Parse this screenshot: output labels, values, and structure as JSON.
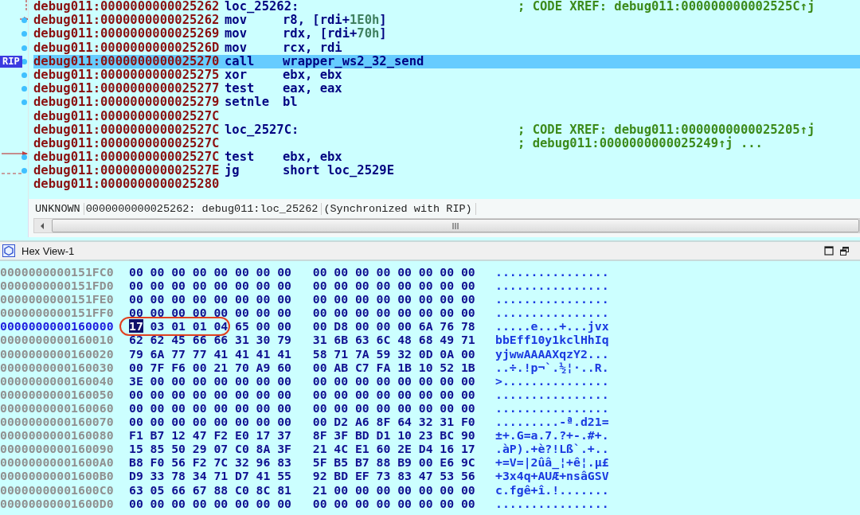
{
  "listing": {
    "rip_label": "RIP",
    "lines": [
      {
        "address": "debug011:0000000000025262",
        "kind": "label",
        "label": "loc_25262:",
        "comment": "; CODE XREF: debug011:000000000002525C↑j",
        "dot": false,
        "selected": false
      },
      {
        "address": "debug011:0000000000025262",
        "kind": "insn",
        "mnemonic": "mov",
        "operands": [
          {
            "text": "r8, [rdi+",
            "kind": "reg"
          },
          {
            "text": "1E0h",
            "kind": "imm"
          },
          {
            "text": "]",
            "kind": "reg"
          }
        ],
        "dot": true,
        "selected": false
      },
      {
        "address": "debug011:0000000000025269",
        "kind": "insn",
        "mnemonic": "mov",
        "operands": [
          {
            "text": "rdx, [rdi+",
            "kind": "reg"
          },
          {
            "text": "70h",
            "kind": "imm"
          },
          {
            "text": "]",
            "kind": "reg"
          }
        ],
        "dot": true,
        "selected": false
      },
      {
        "address": "debug011:000000000002526D",
        "kind": "insn",
        "mnemonic": "mov",
        "operands": [
          {
            "text": "rcx, rdi",
            "kind": "reg"
          }
        ],
        "dot": true,
        "selected": false
      },
      {
        "address": "debug011:0000000000025270",
        "kind": "insn",
        "mnemonic": "call",
        "operands": [
          {
            "text": "wrapper_ws2_32_send",
            "kind": "reg"
          }
        ],
        "dot": true,
        "selected": true
      },
      {
        "address": "debug011:0000000000025275",
        "kind": "insn",
        "mnemonic": "xor",
        "operands": [
          {
            "text": "ebx, ebx",
            "kind": "reg"
          }
        ],
        "dot": true,
        "selected": false
      },
      {
        "address": "debug011:0000000000025277",
        "kind": "insn",
        "mnemonic": "test",
        "operands": [
          {
            "text": "eax, eax",
            "kind": "reg"
          }
        ],
        "dot": true,
        "selected": false
      },
      {
        "address": "debug011:0000000000025279",
        "kind": "insn",
        "mnemonic": "setnle",
        "operands": [
          {
            "text": "bl",
            "kind": "reg"
          }
        ],
        "dot": true,
        "selected": false
      },
      {
        "address": "debug011:000000000002527C",
        "kind": "plain",
        "dot": false,
        "selected": false
      },
      {
        "address": "debug011:000000000002527C",
        "kind": "label",
        "label": "loc_2527C:",
        "comment": "; CODE XREF: debug011:0000000000025205↑j",
        "dot": false,
        "selected": false
      },
      {
        "address": "debug011:000000000002527C",
        "kind": "plain",
        "comment": "; debug011:0000000000025249↑j ...",
        "dot": false,
        "selected": false
      },
      {
        "address": "debug011:000000000002527C",
        "kind": "insn",
        "mnemonic": "test",
        "operands": [
          {
            "text": "ebx, ebx",
            "kind": "reg"
          }
        ],
        "dot": true,
        "selected": false
      },
      {
        "address": "debug011:000000000002527E",
        "kind": "insn",
        "mnemonic": "jg",
        "operands": [
          {
            "text": "short loc_2529E",
            "kind": "reg"
          }
        ],
        "dot": true,
        "selected": false
      },
      {
        "address": "debug011:0000000000025280",
        "kind": "plain",
        "dot": false,
        "selected": false
      }
    ]
  },
  "status_bar": {
    "fields": [
      "UNKNOWN",
      "0000000000025262: debug011:loc_25262",
      "(Synchronized with RIP)"
    ]
  },
  "hex_view": {
    "title": "Hex View-1",
    "rows": [
      {
        "address": "0000000000151FC0",
        "selected": false,
        "circled": false,
        "bytes": [
          "00",
          "00",
          "00",
          "00",
          "00",
          "00",
          "00",
          "00",
          "00",
          "00",
          "00",
          "00",
          "00",
          "00",
          "00",
          "00"
        ],
        "ascii": "................"
      },
      {
        "address": "0000000000151FD0",
        "selected": false,
        "circled": false,
        "bytes": [
          "00",
          "00",
          "00",
          "00",
          "00",
          "00",
          "00",
          "00",
          "00",
          "00",
          "00",
          "00",
          "00",
          "00",
          "00",
          "00"
        ],
        "ascii": "................"
      },
      {
        "address": "0000000000151FE0",
        "selected": false,
        "circled": false,
        "bytes": [
          "00",
          "00",
          "00",
          "00",
          "00",
          "00",
          "00",
          "00",
          "00",
          "00",
          "00",
          "00",
          "00",
          "00",
          "00",
          "00"
        ],
        "ascii": "................"
      },
      {
        "address": "0000000000151FF0",
        "selected": false,
        "circled": false,
        "bytes": [
          "00",
          "00",
          "00",
          "00",
          "00",
          "00",
          "00",
          "00",
          "00",
          "00",
          "00",
          "00",
          "00",
          "00",
          "00",
          "00"
        ],
        "ascii": "................"
      },
      {
        "address": "0000000000160000",
        "selected": true,
        "circled": true,
        "bytes": [
          "17",
          "03",
          "01",
          "01",
          "04",
          "65",
          "00",
          "00",
          "00",
          "D8",
          "00",
          "00",
          "00",
          "6A",
          "76",
          "78"
        ],
        "ascii": ".....e...+...jvx"
      },
      {
        "address": "0000000000160010",
        "selected": false,
        "circled": false,
        "bytes": [
          "62",
          "62",
          "45",
          "66",
          "66",
          "31",
          "30",
          "79",
          "31",
          "6B",
          "63",
          "6C",
          "48",
          "68",
          "49",
          "71"
        ],
        "ascii": "bbEff10y1kclHhIq"
      },
      {
        "address": "0000000000160020",
        "selected": false,
        "circled": false,
        "bytes": [
          "79",
          "6A",
          "77",
          "77",
          "41",
          "41",
          "41",
          "41",
          "58",
          "71",
          "7A",
          "59",
          "32",
          "0D",
          "0A",
          "00"
        ],
        "ascii": "yjwwAAAAXqzY2..."
      },
      {
        "address": "0000000000160030",
        "selected": false,
        "circled": false,
        "bytes": [
          "00",
          "7F",
          "F6",
          "00",
          "21",
          "70",
          "A9",
          "60",
          "00",
          "AB",
          "C7",
          "FA",
          "1B",
          "10",
          "52",
          "1B"
        ],
        "ascii": "..÷.!p¬`.½¦·..R."
      },
      {
        "address": "0000000000160040",
        "selected": false,
        "circled": false,
        "bytes": [
          "3E",
          "00",
          "00",
          "00",
          "00",
          "00",
          "00",
          "00",
          "00",
          "00",
          "00",
          "00",
          "00",
          "00",
          "00",
          "00"
        ],
        "ascii": ">..............."
      },
      {
        "address": "0000000000160050",
        "selected": false,
        "circled": false,
        "bytes": [
          "00",
          "00",
          "00",
          "00",
          "00",
          "00",
          "00",
          "00",
          "00",
          "00",
          "00",
          "00",
          "00",
          "00",
          "00",
          "00"
        ],
        "ascii": "................"
      },
      {
        "address": "0000000000160060",
        "selected": false,
        "circled": false,
        "bytes": [
          "00",
          "00",
          "00",
          "00",
          "00",
          "00",
          "00",
          "00",
          "00",
          "00",
          "00",
          "00",
          "00",
          "00",
          "00",
          "00"
        ],
        "ascii": "................"
      },
      {
        "address": "0000000000160070",
        "selected": false,
        "circled": false,
        "bytes": [
          "00",
          "00",
          "00",
          "00",
          "00",
          "00",
          "00",
          "00",
          "00",
          "D2",
          "A6",
          "8F",
          "64",
          "32",
          "31",
          "F0"
        ],
        "ascii": ".........-ª.d21="
      },
      {
        "address": "0000000000160080",
        "selected": false,
        "circled": false,
        "bytes": [
          "F1",
          "B7",
          "12",
          "47",
          "F2",
          "E0",
          "17",
          "37",
          "8F",
          "3F",
          "BD",
          "D1",
          "10",
          "23",
          "BC",
          "90"
        ],
        "ascii": "±+.G=a.7.?+-.#+."
      },
      {
        "address": "0000000000160090",
        "selected": false,
        "circled": false,
        "bytes": [
          "15",
          "85",
          "50",
          "29",
          "07",
          "C0",
          "8A",
          "3F",
          "21",
          "4C",
          "E1",
          "60",
          "2E",
          "D4",
          "16",
          "17"
        ],
        "ascii": ".àP).+è?!Lß`.+.."
      },
      {
        "address": "00000000001600A0",
        "selected": false,
        "circled": false,
        "bytes": [
          "B8",
          "F0",
          "56",
          "F2",
          "7C",
          "32",
          "96",
          "83",
          "5F",
          "B5",
          "B7",
          "88",
          "B9",
          "00",
          "E6",
          "9C"
        ],
        "ascii": "+=V=|2ûâ_¦+ê¦.µ£"
      },
      {
        "address": "00000000001600B0",
        "selected": false,
        "circled": false,
        "bytes": [
          "D9",
          "33",
          "78",
          "34",
          "71",
          "D7",
          "41",
          "55",
          "92",
          "BD",
          "EF",
          "73",
          "83",
          "47",
          "53",
          "56"
        ],
        "ascii": "+3x4q+AUÆ+nsâGSV"
      },
      {
        "address": "00000000001600C0",
        "selected": false,
        "circled": false,
        "bytes": [
          "63",
          "05",
          "66",
          "67",
          "88",
          "C0",
          "8C",
          "81",
          "21",
          "00",
          "00",
          "00",
          "00",
          "00",
          "00",
          "00"
        ],
        "ascii": "c.fgê+î.!......."
      },
      {
        "address": "00000000001600D0",
        "selected": false,
        "circled": false,
        "bytes": [
          "00",
          "00",
          "00",
          "00",
          "00",
          "00",
          "00",
          "00",
          "00",
          "00",
          "00",
          "00",
          "00",
          "00",
          "00",
          "00"
        ],
        "ascii": "................"
      }
    ]
  }
}
